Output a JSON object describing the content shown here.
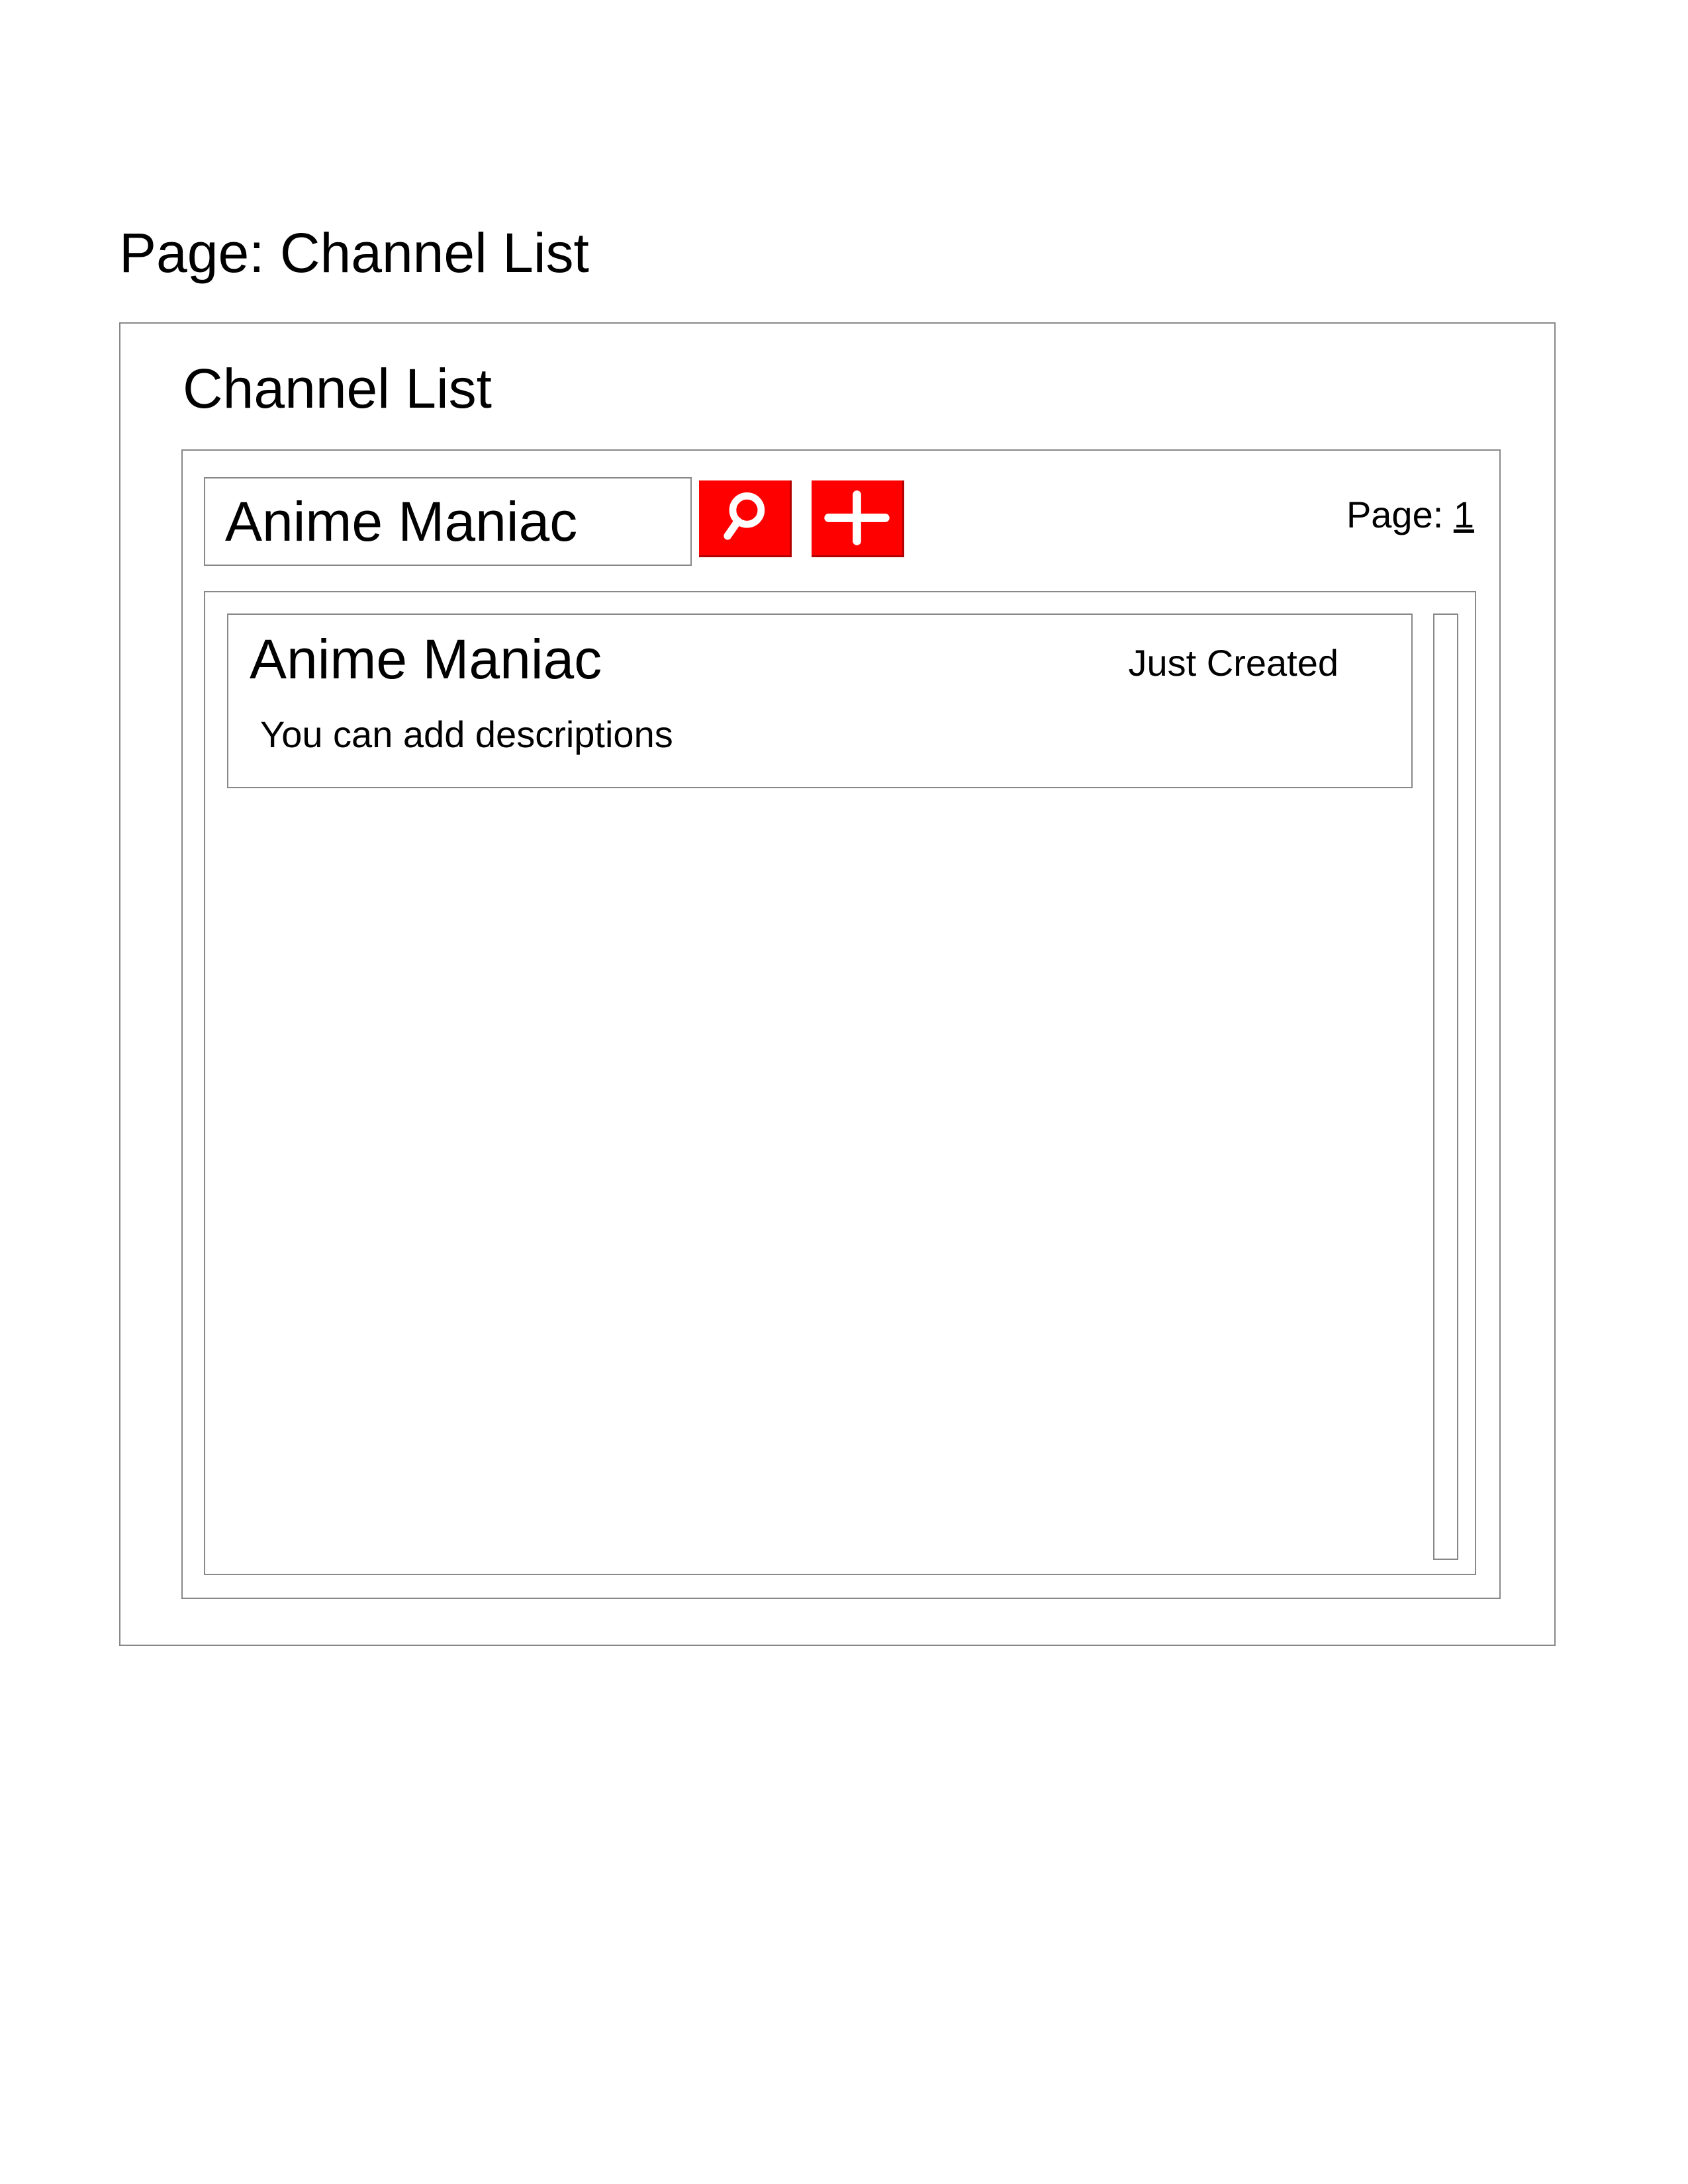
{
  "page": {
    "heading": "Page: Channel List"
  },
  "panel": {
    "title": "Channel List"
  },
  "toolbar": {
    "search_value": "Anime Maniac",
    "search_icon": "search-icon",
    "add_icon": "plus-icon",
    "accent_color": "#ff0000"
  },
  "pager": {
    "label": "Page:",
    "current": "1"
  },
  "channels": [
    {
      "name": "Anime Maniac",
      "status": "Just Created",
      "description": "You can add descriptions"
    }
  ]
}
